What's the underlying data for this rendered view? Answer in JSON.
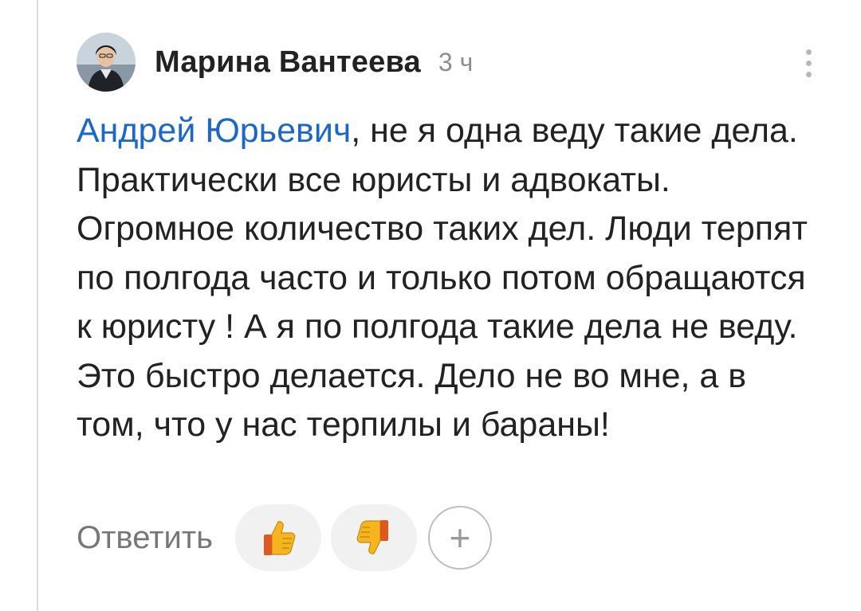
{
  "comment": {
    "author": "Марина Вантеева",
    "time": "3 ч",
    "mention": "Андрей Юрьевич",
    "text_after_mention": ", не я одна веду такие дела. Практически все юристы и адвокаты. Огромное количество таких дел. Люди терпят по полгода часто и только потом обращаются к юристу ! А я по полгода такие дела не веду. Это быстро делается. Дело не во мне, а в том, что у нас терпилы и бараны!"
  },
  "actions": {
    "reply_label": "Ответить",
    "like_icon": "thumbs-up-icon",
    "dislike_icon": "thumbs-down-icon",
    "add_reaction_label": "+"
  },
  "menu": {
    "icon": "more-vertical-icon"
  },
  "colors": {
    "mention": "#1d67c9",
    "text": "#222222",
    "muted": "#8d8d8d",
    "reaction_bg": "#f1f1f1"
  }
}
